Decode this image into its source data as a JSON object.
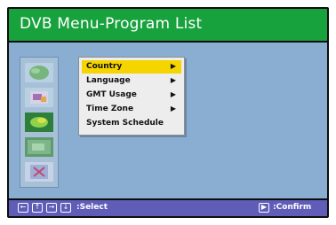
{
  "title_bar": {
    "title": "DVB Menu-Program List"
  },
  "sidebar": {
    "icons": [
      "globe-icon",
      "tools-icon",
      "leaf-icon",
      "image-icon",
      "cross-icon"
    ]
  },
  "menu": {
    "items": [
      {
        "label": "Country",
        "has_submenu": true,
        "selected": true
      },
      {
        "label": "Language",
        "has_submenu": true,
        "selected": false
      },
      {
        "label": "GMT Usage",
        "has_submenu": true,
        "selected": false
      },
      {
        "label": "Time Zone",
        "has_submenu": true,
        "selected": false
      },
      {
        "label": "System Schedule",
        "has_submenu": false,
        "selected": false
      }
    ],
    "arrow": "▶"
  },
  "bottom_bar": {
    "select_keys": [
      "←",
      "↑",
      "→",
      "↓"
    ],
    "select_label": ":Select",
    "confirm_key": "▶",
    "confirm_label": ":Confirm"
  },
  "colors": {
    "title_bar": "#17a23e",
    "content_bg": "#8aaed2",
    "bottom_bar": "#5f5db8",
    "highlight": "#f5d400"
  }
}
